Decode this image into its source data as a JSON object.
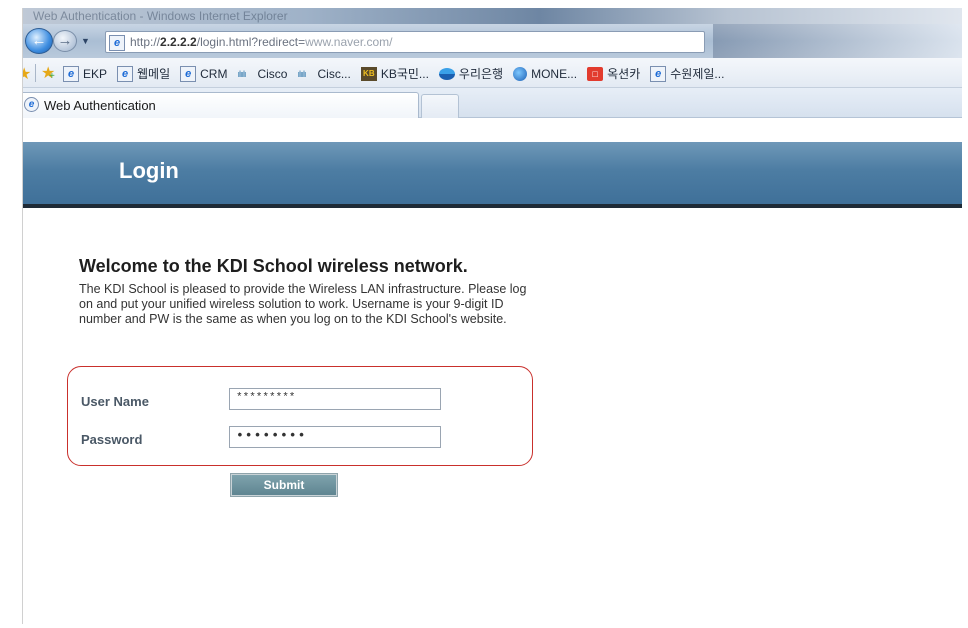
{
  "window": {
    "title": "Web Authentication - Windows Internet Explorer"
  },
  "address_bar": {
    "url_prefix": "http://",
    "url_host": "2.2.2.2",
    "url_path": "/login.html?redirect=",
    "url_tail": "www.naver.com/"
  },
  "favorites": {
    "items": [
      {
        "label": "EKP",
        "icon": "ie-page-icon"
      },
      {
        "label": "웹메일",
        "icon": "ie-page-icon"
      },
      {
        "label": "CRM",
        "icon": "ie-page-icon"
      },
      {
        "label": "Cisco",
        "icon": "cisco-icon"
      },
      {
        "label": "Cisc...",
        "icon": "cisco-icon"
      },
      {
        "label": "KB국민...",
        "icon": "kb-icon"
      },
      {
        "label": "우리은행",
        "icon": "woori-icon"
      },
      {
        "label": "MONE...",
        "icon": "globe-icon"
      },
      {
        "label": "옥션카",
        "icon": "auction-icon"
      },
      {
        "label": "수원제일...",
        "icon": "ie-page-icon"
      }
    ]
  },
  "tab": {
    "label": "Web Authentication"
  },
  "page": {
    "header": "Login",
    "welcome": "Welcome to the KDI School wireless network.",
    "description": "The KDI School is pleased to provide the Wireless LAN infrastructure. Please log on and put your unified wireless solution to work. Username is your 9-digit ID number and PW is the same as when you log on to the KDI School's website.",
    "username_label": "User Name",
    "username_value": "*********",
    "password_label": "Password",
    "password_value": "••••••••",
    "submit_label": "Submit"
  },
  "colors": {
    "header_blue": "#4d7da3",
    "highlight_red": "#c9302c",
    "submit_teal": "#6f939e"
  }
}
